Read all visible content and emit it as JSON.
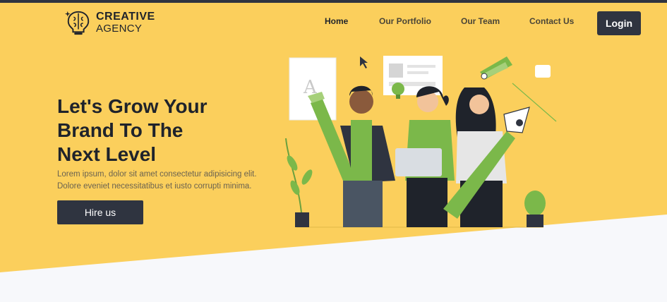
{
  "brand": {
    "line1": "CREATIVE",
    "line2": "AGENCY"
  },
  "nav": {
    "items": [
      {
        "label": "Home",
        "active": true
      },
      {
        "label": "Our Portfolio",
        "active": false
      },
      {
        "label": "Our Team",
        "active": false
      },
      {
        "label": "Contact Us",
        "active": false
      }
    ],
    "login_label": "Login"
  },
  "hero": {
    "title_lines": [
      "Let's Grow Your",
      "Brand To The",
      "Next Level"
    ],
    "text_lines": [
      "Lorem ipsum, dolor sit amet consectetur adipisicing elit.",
      "Dolore eveniet necessitatibus et iusto corrupti minima."
    ],
    "cta_label": "Hire us"
  },
  "colors": {
    "background": "#fbcf5c",
    "dark": "#2f3440",
    "bottom": "#f7f8fb",
    "green": "#7bb84a"
  },
  "illustration": {
    "subject": "team-illustration",
    "letter_card": "A"
  }
}
